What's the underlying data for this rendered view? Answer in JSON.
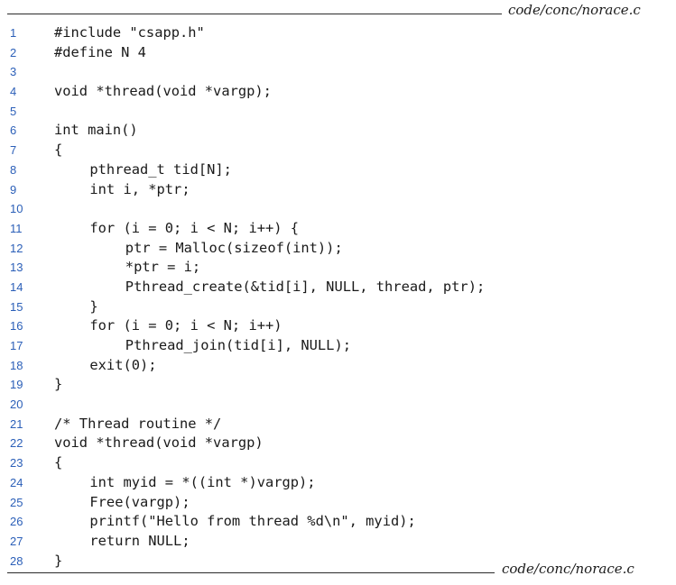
{
  "header": {
    "filename": "code/conc/norace.c"
  },
  "footer": {
    "filename": "code/conc/norace.c"
  },
  "colors": {
    "line_number": "#2b5fb8",
    "code_text": "#1a1a1a"
  },
  "code_lines": [
    {
      "number": "1",
      "indent": 0,
      "code": "#include \"csapp.h\""
    },
    {
      "number": "2",
      "indent": 0,
      "code": "#define N 4"
    },
    {
      "number": "3",
      "indent": 0,
      "code": ""
    },
    {
      "number": "4",
      "indent": 0,
      "code": "void *thread(void *vargp);"
    },
    {
      "number": "5",
      "indent": 0,
      "code": ""
    },
    {
      "number": "6",
      "indent": 0,
      "code": "int main()"
    },
    {
      "number": "7",
      "indent": 0,
      "code": "{"
    },
    {
      "number": "8",
      "indent": 1,
      "code": "pthread_t tid[N];"
    },
    {
      "number": "9",
      "indent": 1,
      "code": "int i, *ptr;"
    },
    {
      "number": "10",
      "indent": 0,
      "code": ""
    },
    {
      "number": "11",
      "indent": 1,
      "code": "for (i = 0; i < N; i++) {"
    },
    {
      "number": "12",
      "indent": 2,
      "code": "ptr = Malloc(sizeof(int));"
    },
    {
      "number": "13",
      "indent": 2,
      "code": "*ptr = i;"
    },
    {
      "number": "14",
      "indent": 2,
      "code": "Pthread_create(&tid[i], NULL, thread, ptr);"
    },
    {
      "number": "15",
      "indent": 1,
      "code": "}"
    },
    {
      "number": "16",
      "indent": 1,
      "code": "for (i = 0; i < N; i++)"
    },
    {
      "number": "17",
      "indent": 2,
      "code": "Pthread_join(tid[i], NULL);"
    },
    {
      "number": "18",
      "indent": 1,
      "code": "exit(0);"
    },
    {
      "number": "19",
      "indent": 0,
      "code": "}"
    },
    {
      "number": "20",
      "indent": 0,
      "code": ""
    },
    {
      "number": "21",
      "indent": 0,
      "code": "/* Thread routine */"
    },
    {
      "number": "22",
      "indent": 0,
      "code": "void *thread(void *vargp)"
    },
    {
      "number": "23",
      "indent": 0,
      "code": "{"
    },
    {
      "number": "24",
      "indent": 1,
      "code": "int myid = *((int *)vargp);"
    },
    {
      "number": "25",
      "indent": 1,
      "code": "Free(vargp);"
    },
    {
      "number": "26",
      "indent": 1,
      "code": "printf(\"Hello from thread %d\\n\", myid);"
    },
    {
      "number": "27",
      "indent": 1,
      "code": "return NULL;"
    },
    {
      "number": "28",
      "indent": 0,
      "code": "}"
    }
  ]
}
